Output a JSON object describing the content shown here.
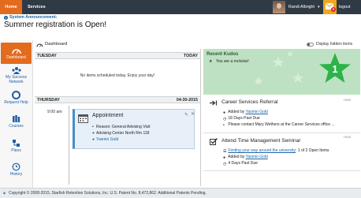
{
  "topbar": {
    "home_label": "Home",
    "services_label": "Services",
    "user_name": "Randi Albright",
    "mail_count": "5",
    "logout_label": "logout",
    "accent": "#e36b1d",
    "bar_color": "#2f3a45"
  },
  "announcement": {
    "label": "System Announcement:",
    "text": "Summer registration is Open!"
  },
  "nav": [
    {
      "label": "Dashboard",
      "icon": "dashboard-icon",
      "active": true
    },
    {
      "label": "My Success",
      "label2": "Network",
      "icon": "network-icon"
    },
    {
      "label": "Request Help",
      "icon": "lifebuoy-icon"
    },
    {
      "label": "Courses",
      "icon": "books-icon"
    },
    {
      "label": "Plans",
      "icon": "plans-icon"
    },
    {
      "label": "History",
      "icon": "history-icon"
    }
  ],
  "dashboard": {
    "title": "Dashboard",
    "toggle_label": "Display hidden items"
  },
  "calendar": {
    "tuesday_label": "TUESDAY",
    "today_label": "TODAY",
    "no_items": "No items scheduled today. Enjoy your day!",
    "thursday_label": "THURSDAY",
    "thursday_date": "04-30-2015",
    "time": "9:00 am",
    "appointment": {
      "title": "Appointment",
      "reason": "Reason: General Advising Visit",
      "location": "Advising Center North Rm 118",
      "person": "Yasmin Gold"
    }
  },
  "kudos": {
    "title": "Recent Kudos",
    "message": "You are a rockstar!",
    "count": "1",
    "color": "#2db34a"
  },
  "cards": [
    {
      "title": "Career Services Referral",
      "hide": "HIDE",
      "added_by_prefix": "Added by ",
      "added_by": "Yasmin Gold",
      "due": "18 Days Past Due",
      "note": "Please contact Mary Wethers at the Career Services office ..."
    },
    {
      "title": "Attend Time Management Seminar",
      "hide": "HIDE",
      "task_link": "Finding your way around the university",
      "task_suffix": ": 1 of 2 Open Items",
      "added_by_prefix": "Added by ",
      "added_by": "Yasmin Gold",
      "due": "4 Days Past Due"
    }
  ],
  "footer": {
    "text": "Copyright © 2008-2015, Starfish Retention Solutions, Inc. U.S. Patent No. 8,472,862. Additional Patents Pending."
  }
}
